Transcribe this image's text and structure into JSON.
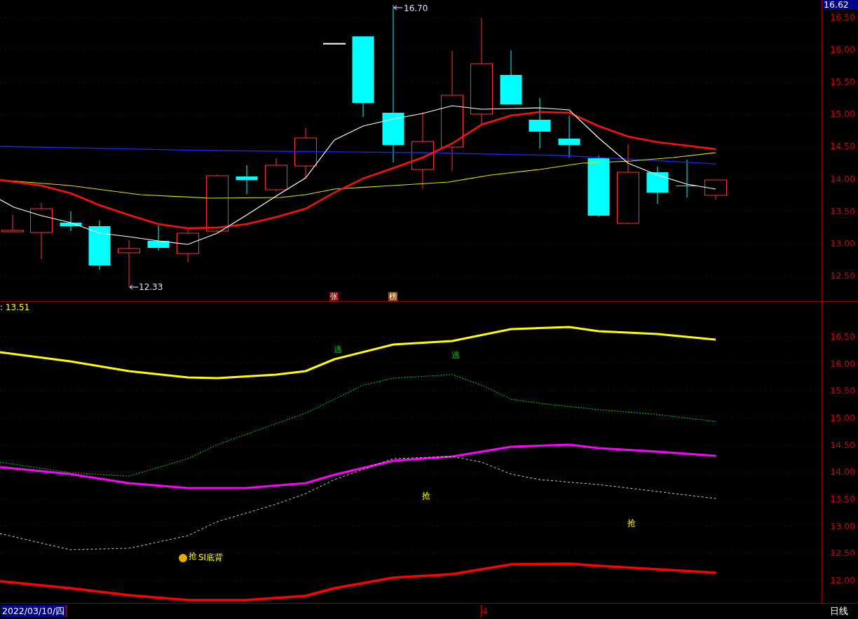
{
  "price_pane": {
    "current_price": "16.62",
    "high_label": "16.70",
    "low_label": "12.33",
    "badges": [
      {
        "text": "张",
        "color": "#8b0000"
      },
      {
        "text": "榜",
        "color": "#8b4a10"
      }
    ],
    "axis_ticks": [
      "16.50",
      "16.00",
      "15.50",
      "15.00",
      "14.50",
      "14.00",
      "13.50",
      "13.00",
      "12.50"
    ]
  },
  "indicator_pane": {
    "value_label": ": 13.51",
    "signals": [
      {
        "text": "逃",
        "kind": "escape"
      },
      {
        "text": "逃",
        "kind": "escape"
      },
      {
        "text": "抢",
        "kind": "grab"
      },
      {
        "text": "抢",
        "kind": "grab"
      },
      {
        "text": "抢",
        "kind": "grab"
      }
    ],
    "divergence_label": "SI底背",
    "axis_ticks": [
      "16.50",
      "16.00",
      "15.50",
      "15.00",
      "14.50",
      "14.00",
      "13.50",
      "13.00",
      "12.50",
      "12.00"
    ]
  },
  "time_axis": {
    "date": "2022/03/10/四",
    "marker": "4",
    "period": "日线"
  }
}
